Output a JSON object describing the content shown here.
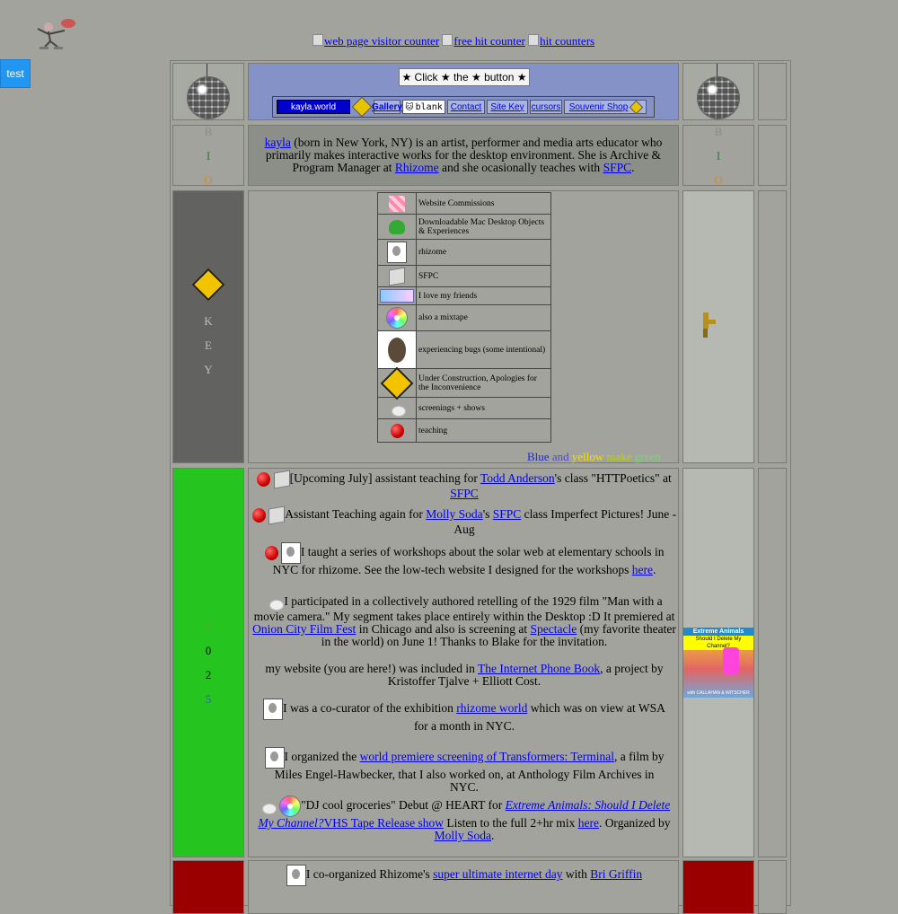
{
  "test_button": "test",
  "counters": [
    "web page visitor counter",
    "free hit counter",
    "hit counters"
  ],
  "header": {
    "click_button": "★ Click ★ the ★ button ★",
    "nav": [
      "kayla.world",
      "Gallery",
      "blank",
      "Contact",
      "Site Key",
      "cursors",
      "Souvenir Shop"
    ]
  },
  "bio_side": [
    "B",
    "I",
    "O"
  ],
  "bio_colors": [
    "#8a8a88",
    "#2a7a2a",
    "#d08a30"
  ],
  "bio": {
    "name_link": "kayla",
    "text1": " (born in New York, NY) is an artist, performer and media arts educator who primarily makes interactive works for the desktop environment. She is Archive & Program Manager at ",
    "rhizome_link": "Rhizome",
    "text2": " and she ocasionally teaches with ",
    "sfpc_link": "SFPC",
    "text3": "."
  },
  "key_side": [
    "K",
    "E",
    "Y"
  ],
  "key_items": [
    {
      "label": "Website Commissions",
      "icon": "pink-tile-icon"
    },
    {
      "label": "Downloadable Mac Desktop Objects & Experiences",
      "icon": "frog-icon"
    },
    {
      "label": "rhizome",
      "icon": "face-icon"
    },
    {
      "label": "SFPC",
      "icon": "dice-icon"
    },
    {
      "label": "I love my friends",
      "icon": "friend-badge-icon"
    },
    {
      "label": "also a mixtape",
      "icon": "cd-icon"
    },
    {
      "label": "experiencing bugs (some intentional)",
      "icon": "bug-icon"
    },
    {
      "label": "Under Construction, Apologies for the Inconvenience",
      "icon": "construction-sign-icon"
    },
    {
      "label": "screenings + shows",
      "icon": "cat-icon"
    },
    {
      "label": "teaching",
      "icon": "apple-icon"
    }
  ],
  "color_caption": {
    "blue": "Blue",
    "and": " and ",
    "yellow": "yellow",
    "make": " make ",
    "green": "green"
  },
  "year_side": [
    "2",
    "0",
    "2",
    "5"
  ],
  "year_colors": [
    "#6a9a38",
    "#000000",
    "#000000",
    "#2a6a9a"
  ],
  "news": {
    "item1": {
      "text": "[Upcoming July] assistant teaching for ",
      "l1": "Todd Anderson",
      "t2": "'s class \"HTTPoetics\" at ",
      "l2": "SFPC"
    },
    "item2": {
      "text": "Assistant Teaching again for ",
      "l1": "Molly Soda",
      "t2": "'s ",
      "l2": "SFPC",
      "t3": " class Imperfect Pictures! June - Aug"
    },
    "item3": {
      "text": "I taught a series of workshops about the solar web at elementary schools in NYC for rhizome. See the low-tech website I designed for the workshops ",
      "l1": "here",
      "t2": "."
    },
    "item4": {
      "text": "I participated in a collectively authored retelling of the 1929 film \"Man with a movie camera.\" My segment takes place entirely within the Desktop :D It premiered at ",
      "l1": "Onion City Film Fest",
      "t2": " in Chicago and also is screening at ",
      "l2": "Spectacle",
      "t3": " (my favorite theater in the world) on June 1! Thanks to Blake for the invitation."
    },
    "item5": {
      "text": "my website (you are here!) was included in ",
      "l1": "The Internet Phone Book",
      "t2": ", a project by Kristoffer Tjalve + Elliott Cost."
    },
    "item6": {
      "text": "I was a co-curator of the exhibition ",
      "l1": "rhizome world",
      "t2": " which was on view at WSA for a month in NYC."
    },
    "item7": {
      "text": "I organized the ",
      "l1": "world premiere screening of Transformers: Terminal",
      "t2": ", a film by Miles Engel-Hawbecker, that I also worked on, at Anthology Film Archives in NYC."
    },
    "item8": {
      "text": "\"DJ cool groceries\" Debut @ HEART for ",
      "l1": "Extreme Animals: Should I Delete My Channel?",
      "l1b": "VHS Tape Release show",
      "t2": " Listen to the full 2+hr mix ",
      "l2": "here",
      "t3": ". Organized by ",
      "l3": "Molly Soda",
      "t4": "."
    },
    "item9": {
      "text": "I co-organized Rhizome's ",
      "l1": "super ultimate internet day",
      "t2": " with ",
      "l2": "Bri Griffin"
    }
  },
  "side_banner": {
    "title": "Extreme Animals",
    "subtitle": "Should I Delete My Channel?",
    "caption": "with CALLAHAN & WITSCHER"
  },
  "colors": {
    "nav_bg": "#8492c8",
    "bio_bg": "#8b8f88",
    "key_side_bg": "#626260",
    "year_side_bg": "#26c41f",
    "red_side_bg": "#9a0000"
  }
}
